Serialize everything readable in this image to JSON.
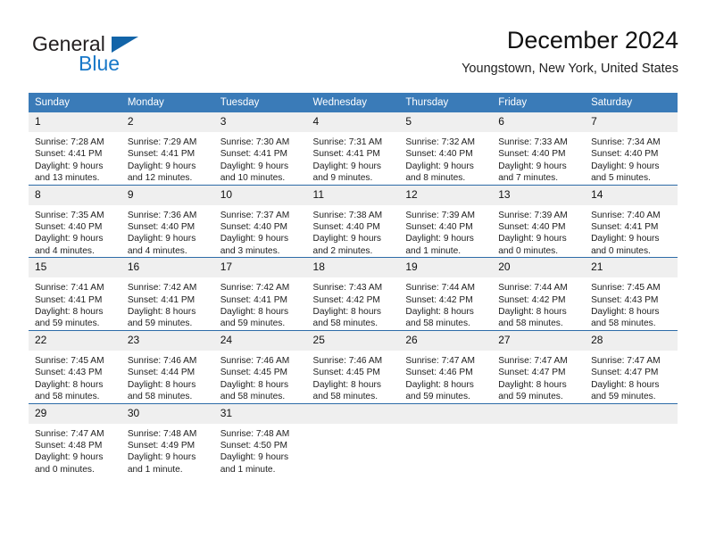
{
  "brand": {
    "name_top": "General",
    "name_bottom": "Blue",
    "accent_color": "#1878c8",
    "triangle_color": "#1264a8"
  },
  "header": {
    "title": "December 2024",
    "subtitle": "Youngstown, New York, United States"
  },
  "theme": {
    "header_blue": "#3a7bb8",
    "row_divider_blue": "#2d6ca8",
    "daynum_band": "#efefef"
  },
  "calendar": {
    "weekday_headers": [
      "Sunday",
      "Monday",
      "Tuesday",
      "Wednesday",
      "Thursday",
      "Friday",
      "Saturday"
    ],
    "weeks": [
      [
        {
          "day": "1",
          "sunrise": "Sunrise: 7:28 AM",
          "sunset": "Sunset: 4:41 PM",
          "daylight_line1": "Daylight: 9 hours",
          "daylight_line2": "and 13 minutes."
        },
        {
          "day": "2",
          "sunrise": "Sunrise: 7:29 AM",
          "sunset": "Sunset: 4:41 PM",
          "daylight_line1": "Daylight: 9 hours",
          "daylight_line2": "and 12 minutes."
        },
        {
          "day": "3",
          "sunrise": "Sunrise: 7:30 AM",
          "sunset": "Sunset: 4:41 PM",
          "daylight_line1": "Daylight: 9 hours",
          "daylight_line2": "and 10 minutes."
        },
        {
          "day": "4",
          "sunrise": "Sunrise: 7:31 AM",
          "sunset": "Sunset: 4:41 PM",
          "daylight_line1": "Daylight: 9 hours",
          "daylight_line2": "and 9 minutes."
        },
        {
          "day": "5",
          "sunrise": "Sunrise: 7:32 AM",
          "sunset": "Sunset: 4:40 PM",
          "daylight_line1": "Daylight: 9 hours",
          "daylight_line2": "and 8 minutes."
        },
        {
          "day": "6",
          "sunrise": "Sunrise: 7:33 AM",
          "sunset": "Sunset: 4:40 PM",
          "daylight_line1": "Daylight: 9 hours",
          "daylight_line2": "and 7 minutes."
        },
        {
          "day": "7",
          "sunrise": "Sunrise: 7:34 AM",
          "sunset": "Sunset: 4:40 PM",
          "daylight_line1": "Daylight: 9 hours",
          "daylight_line2": "and 5 minutes."
        }
      ],
      [
        {
          "day": "8",
          "sunrise": "Sunrise: 7:35 AM",
          "sunset": "Sunset: 4:40 PM",
          "daylight_line1": "Daylight: 9 hours",
          "daylight_line2": "and 4 minutes."
        },
        {
          "day": "9",
          "sunrise": "Sunrise: 7:36 AM",
          "sunset": "Sunset: 4:40 PM",
          "daylight_line1": "Daylight: 9 hours",
          "daylight_line2": "and 4 minutes."
        },
        {
          "day": "10",
          "sunrise": "Sunrise: 7:37 AM",
          "sunset": "Sunset: 4:40 PM",
          "daylight_line1": "Daylight: 9 hours",
          "daylight_line2": "and 3 minutes."
        },
        {
          "day": "11",
          "sunrise": "Sunrise: 7:38 AM",
          "sunset": "Sunset: 4:40 PM",
          "daylight_line1": "Daylight: 9 hours",
          "daylight_line2": "and 2 minutes."
        },
        {
          "day": "12",
          "sunrise": "Sunrise: 7:39 AM",
          "sunset": "Sunset: 4:40 PM",
          "daylight_line1": "Daylight: 9 hours",
          "daylight_line2": "and 1 minute."
        },
        {
          "day": "13",
          "sunrise": "Sunrise: 7:39 AM",
          "sunset": "Sunset: 4:40 PM",
          "daylight_line1": "Daylight: 9 hours",
          "daylight_line2": "and 0 minutes."
        },
        {
          "day": "14",
          "sunrise": "Sunrise: 7:40 AM",
          "sunset": "Sunset: 4:41 PM",
          "daylight_line1": "Daylight: 9 hours",
          "daylight_line2": "and 0 minutes."
        }
      ],
      [
        {
          "day": "15",
          "sunrise": "Sunrise: 7:41 AM",
          "sunset": "Sunset: 4:41 PM",
          "daylight_line1": "Daylight: 8 hours",
          "daylight_line2": "and 59 minutes."
        },
        {
          "day": "16",
          "sunrise": "Sunrise: 7:42 AM",
          "sunset": "Sunset: 4:41 PM",
          "daylight_line1": "Daylight: 8 hours",
          "daylight_line2": "and 59 minutes."
        },
        {
          "day": "17",
          "sunrise": "Sunrise: 7:42 AM",
          "sunset": "Sunset: 4:41 PM",
          "daylight_line1": "Daylight: 8 hours",
          "daylight_line2": "and 59 minutes."
        },
        {
          "day": "18",
          "sunrise": "Sunrise: 7:43 AM",
          "sunset": "Sunset: 4:42 PM",
          "daylight_line1": "Daylight: 8 hours",
          "daylight_line2": "and 58 minutes."
        },
        {
          "day": "19",
          "sunrise": "Sunrise: 7:44 AM",
          "sunset": "Sunset: 4:42 PM",
          "daylight_line1": "Daylight: 8 hours",
          "daylight_line2": "and 58 minutes."
        },
        {
          "day": "20",
          "sunrise": "Sunrise: 7:44 AM",
          "sunset": "Sunset: 4:42 PM",
          "daylight_line1": "Daylight: 8 hours",
          "daylight_line2": "and 58 minutes."
        },
        {
          "day": "21",
          "sunrise": "Sunrise: 7:45 AM",
          "sunset": "Sunset: 4:43 PM",
          "daylight_line1": "Daylight: 8 hours",
          "daylight_line2": "and 58 minutes."
        }
      ],
      [
        {
          "day": "22",
          "sunrise": "Sunrise: 7:45 AM",
          "sunset": "Sunset: 4:43 PM",
          "daylight_line1": "Daylight: 8 hours",
          "daylight_line2": "and 58 minutes."
        },
        {
          "day": "23",
          "sunrise": "Sunrise: 7:46 AM",
          "sunset": "Sunset: 4:44 PM",
          "daylight_line1": "Daylight: 8 hours",
          "daylight_line2": "and 58 minutes."
        },
        {
          "day": "24",
          "sunrise": "Sunrise: 7:46 AM",
          "sunset": "Sunset: 4:45 PM",
          "daylight_line1": "Daylight: 8 hours",
          "daylight_line2": "and 58 minutes."
        },
        {
          "day": "25",
          "sunrise": "Sunrise: 7:46 AM",
          "sunset": "Sunset: 4:45 PM",
          "daylight_line1": "Daylight: 8 hours",
          "daylight_line2": "and 58 minutes."
        },
        {
          "day": "26",
          "sunrise": "Sunrise: 7:47 AM",
          "sunset": "Sunset: 4:46 PM",
          "daylight_line1": "Daylight: 8 hours",
          "daylight_line2": "and 59 minutes."
        },
        {
          "day": "27",
          "sunrise": "Sunrise: 7:47 AM",
          "sunset": "Sunset: 4:47 PM",
          "daylight_line1": "Daylight: 8 hours",
          "daylight_line2": "and 59 minutes."
        },
        {
          "day": "28",
          "sunrise": "Sunrise: 7:47 AM",
          "sunset": "Sunset: 4:47 PM",
          "daylight_line1": "Daylight: 8 hours",
          "daylight_line2": "and 59 minutes."
        }
      ],
      [
        {
          "day": "29",
          "sunrise": "Sunrise: 7:47 AM",
          "sunset": "Sunset: 4:48 PM",
          "daylight_line1": "Daylight: 9 hours",
          "daylight_line2": "and 0 minutes."
        },
        {
          "day": "30",
          "sunrise": "Sunrise: 7:48 AM",
          "sunset": "Sunset: 4:49 PM",
          "daylight_line1": "Daylight: 9 hours",
          "daylight_line2": "and 1 minute."
        },
        {
          "day": "31",
          "sunrise": "Sunrise: 7:48 AM",
          "sunset": "Sunset: 4:50 PM",
          "daylight_line1": "Daylight: 9 hours",
          "daylight_line2": "and 1 minute."
        },
        {
          "day": "",
          "sunrise": "",
          "sunset": "",
          "daylight_line1": "",
          "daylight_line2": ""
        },
        {
          "day": "",
          "sunrise": "",
          "sunset": "",
          "daylight_line1": "",
          "daylight_line2": ""
        },
        {
          "day": "",
          "sunrise": "",
          "sunset": "",
          "daylight_line1": "",
          "daylight_line2": ""
        },
        {
          "day": "",
          "sunrise": "",
          "sunset": "",
          "daylight_line1": "",
          "daylight_line2": ""
        }
      ]
    ]
  }
}
